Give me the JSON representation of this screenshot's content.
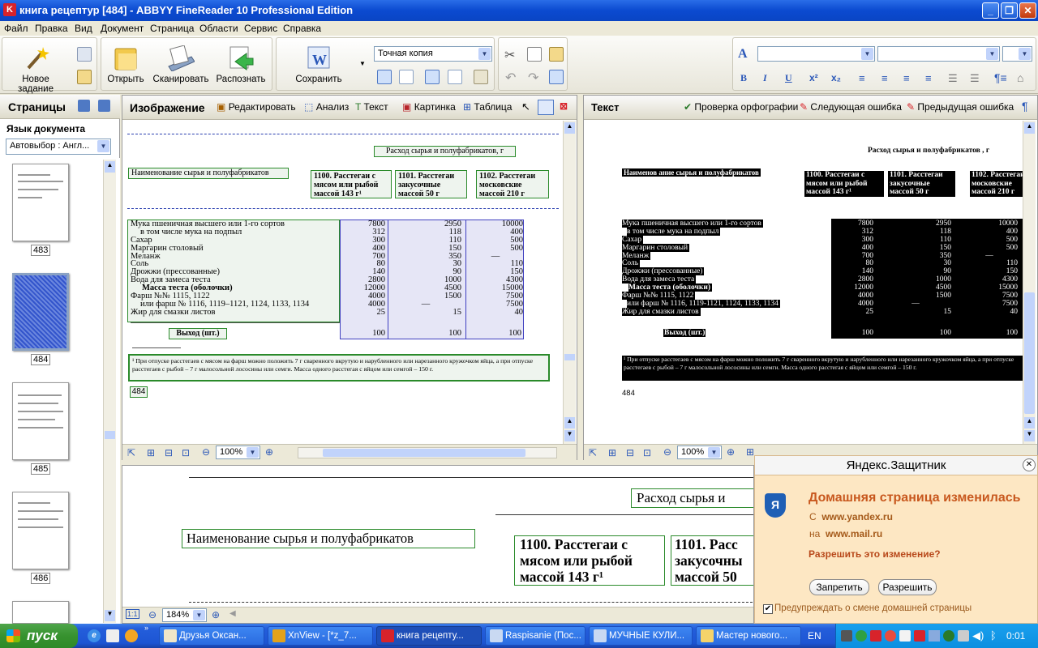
{
  "window": {
    "title": "книга рецептур [484] - ABBYY FineReader 10 Professional Edition",
    "buttons": [
      "_",
      "❐",
      "✕"
    ]
  },
  "menu": [
    "Файл",
    "Правка",
    "Вид",
    "Документ",
    "Страница",
    "Области",
    "Сервис",
    "Справка"
  ],
  "toolbar": {
    "new_task": "Новое задание",
    "open": "Открыть",
    "scan": "Сканировать",
    "recognize": "Распознать",
    "save": "Сохранить",
    "mode": "Точная копия",
    "superscript": "x²",
    "subscript": "x₂"
  },
  "sidebar": {
    "title": "Страницы",
    "lang_label": "Язык документа",
    "lang_value": "Автовыбор : Англ...",
    "pages": [
      "483",
      "484",
      "485",
      "486"
    ]
  },
  "image_panel": {
    "title": "Изображение",
    "tools": [
      "Редактировать",
      "Анализ",
      "Текст",
      "Картинка",
      "Таблица"
    ],
    "zoom": "100%"
  },
  "text_panel": {
    "title": "Текст",
    "spell": "Проверка орфографии",
    "next_err": "Следующая ошибка",
    "prev_err": "Предыдущая ошибка",
    "zoom": "100%"
  },
  "zoom_panel": {
    "zoom": "184%"
  },
  "document": {
    "header": "Расход сырья и полуфабрикатов, г",
    "name_col": "Наименование сырья и полуфабрикатов",
    "col1": "1100. Расстегаи с мясом или рыбой массой 143 г¹",
    "col2": "1101. Расстегаи закусочные массой 50 г",
    "col3": "1102. Расстегаи московские массой 210 г",
    "rows": [
      [
        "Мука пшеничная высшего или 1-го сортов",
        "7800",
        "2950",
        "10000"
      ],
      [
        "в том числе мука на подпыл",
        "312",
        "118",
        "400"
      ],
      [
        "Сахар",
        "300",
        "110",
        "500"
      ],
      [
        "Маргарин столовый",
        "400",
        "150",
        "500"
      ],
      [
        "Меланж",
        "700",
        "350",
        "—"
      ],
      [
        "Соль",
        "80",
        "30",
        "110"
      ],
      [
        "Дрожжи (прессованные)",
        "140",
        "90",
        "150"
      ],
      [
        "Вода для замеса теста",
        "2800",
        "1000",
        "4300"
      ],
      [
        "Масса теста (оболочки)",
        "12000",
        "4500",
        "15000"
      ],
      [
        "Фарш №№ 1115, 1122",
        "4000",
        "1500",
        "7500"
      ],
      [
        "или фарш № 1116, 1119–1121, 1124, 1133, 1134",
        "4000",
        "—",
        "7500"
      ],
      [
        "Жир для смазки листов",
        "25",
        "15",
        "40"
      ]
    ],
    "output_label": "Выход (шт.)",
    "output": [
      "100",
      "100",
      "100"
    ],
    "footnote": "¹ При отпуске расстегаев с мясом на фарш можно положить 7 г сваренного вкрутую и нарубленного или нарезанного кружочком яйца, а при отпуске расстегаев с рыбой – 7 г малосольной лососины или семги. Масса одного расстегая с яйцом или семгой – 150 г.",
    "page_no": "484",
    "text_header": "Расход сырья и полуфабрикатов , г",
    "text_name_col": "Наименов ание сырья и полуфабрикатов",
    "text_col1": "1100. Расстегаи с мясом или рыбой массой 143 г¹",
    "text_col2": "1101. Расстегаи закусочные массой 50 г",
    "text_col3": "1102. Расстегаи московские массой 210 г",
    "text_rows": [
      "Мука пшеничная высшего или 1-го сортов",
      "в том числе мука на подпыл",
      "Сахар",
      "Маргарин столовый",
      "Меланж",
      "Соль",
      "Дрожжи (прессованные)",
      "Вода для замеса теста",
      "Масса теста (оболочки)",
      "Фарш №№ 1115, 1122",
      "или фарш № 1116, 1119-1121, 1124, 1133, 1134",
      "Жир для смазки листов"
    ],
    "zoom_header": "Расход сырья и",
    "zoom_col1": "1100. Расстегаи с мясом или рыбой массой 143 г¹",
    "zoom_col2": "1101. Расс закусочны массой 50"
  },
  "popup": {
    "title": "Яндекс.Защитник",
    "heading": "Домашняя страница изменилась",
    "from_label": "С",
    "from_url": "www.yandex.ru",
    "to_label": "на",
    "to_url": "www.mail.ru",
    "question": "Разрешить это изменение?",
    "deny": "Запретить",
    "allow": "Разрешить",
    "checkbox": "Предупреждать о смене домашней страницы"
  },
  "taskbar": {
    "start": "пуск",
    "items": [
      "Друзья Оксан...",
      "XnView - [*z_7...",
      "книга рецепту...",
      "Raspisanie (Пос...",
      "МУЧНЫЕ КУЛИ...",
      "Мастер нового..."
    ],
    "lang": "EN",
    "clock": "0:01"
  }
}
